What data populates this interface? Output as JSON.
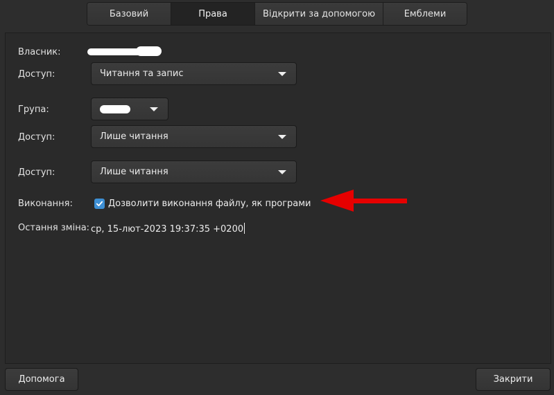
{
  "tabs": [
    {
      "label": "Базовий"
    },
    {
      "label": "Права",
      "active": true
    },
    {
      "label": "Відкрити за допомогою"
    },
    {
      "label": "Емблеми"
    }
  ],
  "owner": {
    "label": "Власник:",
    "access_label": "Доступ:",
    "access_value": "Читання та запис"
  },
  "group": {
    "label": "Група:",
    "access_label": "Доступ:",
    "access_value": "Лише читання"
  },
  "others": {
    "access_label": "Доступ:",
    "access_value": "Лише читання"
  },
  "execute": {
    "label": "Виконання:",
    "checkbox_label": "Дозволити виконання файлу, як програми",
    "checked": true
  },
  "modified": {
    "label": "Остання зміна:",
    "value": "ср, 15-лют-2023 19:37:35 +0200"
  },
  "buttons": {
    "help": "Допомога",
    "close": "Закрити"
  },
  "colors": {
    "accent": "#3d8fd4",
    "annotation_arrow": "#e60000",
    "background": "#2d2d2d"
  }
}
